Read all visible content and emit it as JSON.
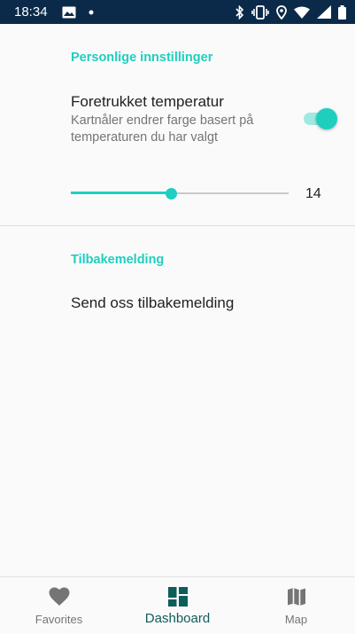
{
  "status_bar": {
    "time": "18:34",
    "left_icons": [
      "image-icon",
      "dot-icon"
    ],
    "right_icons": [
      "bluetooth-icon",
      "vibrate-icon",
      "location-icon",
      "wifi-icon",
      "cell-signal-icon",
      "battery-icon"
    ]
  },
  "settings": {
    "personal_section_title": "Personlige innstillinger",
    "preferred_temperature": {
      "title": "Foretrukket temperatur",
      "subtitle": "Kartnåler endrer farge basert på temperaturen du har valgt",
      "toggle_on": true
    },
    "temperature_slider": {
      "value": "14",
      "fill_fraction": 0.46
    },
    "feedback_section_title": "Tilbakemelding",
    "feedback_item": "Send oss tilbakemelding"
  },
  "bottom_nav": {
    "items": [
      {
        "label": "Favorites",
        "icon": "heart-icon",
        "active": false
      },
      {
        "label": "Dashboard",
        "icon": "dashboard-icon",
        "active": true
      },
      {
        "label": "Map",
        "icon": "map-icon",
        "active": false
      }
    ]
  },
  "colors": {
    "accent": "#1ecfc0",
    "status_bar": "#0b2a4a",
    "nav_active": "#0d5e5a",
    "nav_inactive": "#757575"
  }
}
